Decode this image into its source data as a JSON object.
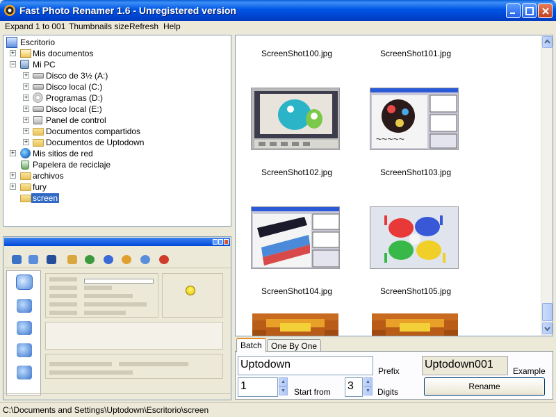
{
  "window": {
    "title": "Fast Photo Renamer 1.6 - Unregistered version",
    "minimize": "_",
    "maximize": "□",
    "close": "×"
  },
  "menu": [
    "Expand 1 to 001",
    "Thumbnails size",
    "Refresh",
    "Help"
  ],
  "tree": [
    {
      "label": "Escritorio",
      "icon": "desktop-icon",
      "level": 0,
      "expander": ""
    },
    {
      "label": "Mis documentos",
      "icon": "folder-icon",
      "level": 1,
      "expander": "+"
    },
    {
      "label": "Mi PC",
      "icon": "computer-icon",
      "level": 1,
      "expander": "−"
    },
    {
      "label": "Disco de 3½ (A:)",
      "icon": "floppy-drive-icon",
      "level": 2,
      "expander": "+"
    },
    {
      "label": "Disco local (C:)",
      "icon": "hard-drive-icon",
      "level": 2,
      "expander": "+"
    },
    {
      "label": "Programas (D:)",
      "icon": "cd-drive-icon",
      "level": 2,
      "expander": "+"
    },
    {
      "label": "Disco local (E:)",
      "icon": "hard-drive-icon",
      "level": 2,
      "expander": "+"
    },
    {
      "label": "Panel de control",
      "icon": "control-panel-icon",
      "level": 2,
      "expander": "+"
    },
    {
      "label": "Documentos compartidos",
      "icon": "folder-icon",
      "level": 2,
      "expander": "+"
    },
    {
      "label": "Documentos de Uptodown",
      "icon": "folder-icon",
      "level": 2,
      "expander": "+"
    },
    {
      "label": "Mis sitios de red",
      "icon": "network-globe-icon",
      "level": 1,
      "expander": "+"
    },
    {
      "label": "Papelera de reciclaje",
      "icon": "recycle-bin-icon",
      "level": 1,
      "expander": ""
    },
    {
      "label": "archivos",
      "icon": "folder-icon",
      "level": 1,
      "expander": "+"
    },
    {
      "label": "fury",
      "icon": "folder-icon",
      "level": 1,
      "expander": "+"
    },
    {
      "label": "screen",
      "icon": "folder-icon",
      "level": 1,
      "expander": "",
      "selected": true
    }
  ],
  "thumbnails": [
    {
      "name": "ScreenShot100.jpg",
      "image": ""
    },
    {
      "name": "ScreenShot101.jpg",
      "image": ""
    },
    {
      "name": "ScreenShot102.jpg",
      "image": "monster-screenshot"
    },
    {
      "name": "ScreenShot103.jpg",
      "image": "paint-screenshot"
    },
    {
      "name": "ScreenShot104.jpg",
      "image": "flag-screenshot"
    },
    {
      "name": "ScreenShot105.jpg",
      "image": "hands-painting"
    },
    {
      "name": "",
      "image": "yellow-pixel"
    },
    {
      "name": "",
      "image": "yellow-pixel"
    }
  ],
  "tabs": {
    "batch": "Batch",
    "one_by_one": "One By One"
  },
  "form": {
    "prefix_value": "Uptodown",
    "prefix_label": "Prefix",
    "example_value": "Uptodown001",
    "example_label": "Example",
    "start_value": "1",
    "start_label": "Start from",
    "digits_value": "3",
    "digits_label": "Digits",
    "rename_label": "Rename"
  },
  "status": {
    "path": "C:\\Documents and Settings\\Uptodown\\Escritorio\\screen"
  },
  "colors": {
    "title_blue": "#0055e5",
    "selection": "#316ac5",
    "tab_accent": "#e68b2c",
    "face": "#ece9d8"
  }
}
